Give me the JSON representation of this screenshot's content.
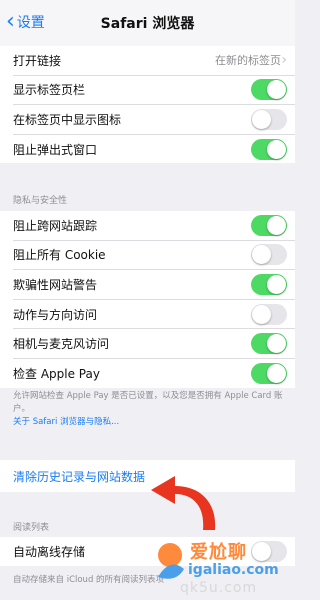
{
  "nav": {
    "back_label": "设置",
    "title": "Safari 浏览器"
  },
  "group1": {
    "open_links": {
      "label": "打开链接",
      "value": "在新的标签页"
    },
    "show_tab_bar": {
      "label": "显示标签页栏",
      "on": true
    },
    "show_icons": {
      "label": "在标签页中显示图标",
      "on": false
    },
    "block_popups": {
      "label": "阻止弹出式窗口",
      "on": true
    }
  },
  "privacy": {
    "header": "隐私与安全性",
    "cross_site": {
      "label": "阻止跨网站跟踪",
      "on": true
    },
    "block_cookie": {
      "label": "阻止所有 Cookie",
      "on": false
    },
    "fraud": {
      "label": "欺骗性网站警告",
      "on": true
    },
    "motion": {
      "label": "动作与方向访问",
      "on": false
    },
    "camera": {
      "label": "相机与麦克风访问",
      "on": true
    },
    "apple_pay": {
      "label": "检查 Apple Pay",
      "on": true
    },
    "footer_text": "允许网站检查 Apple Pay 是否已设置，以及您是否拥有 Apple Card 账户。",
    "footer_link": "关于 Safari 浏览器与隐私..."
  },
  "clear": {
    "label": "清除历史记录与网站数据"
  },
  "reading": {
    "header": "阅读列表",
    "offline": {
      "label": "自动离线存储",
      "on": false
    },
    "footer_text": "自动存储来自 iCloud 的所有阅读列表项"
  },
  "watermark": {
    "line1": "爱尬聊",
    "line2": "igaliao.com",
    "line3": "qk5u.com"
  },
  "colors": {
    "accent": "#1a7cf5",
    "toggle_on": "#4cd964",
    "arrow": "#e8351f"
  }
}
